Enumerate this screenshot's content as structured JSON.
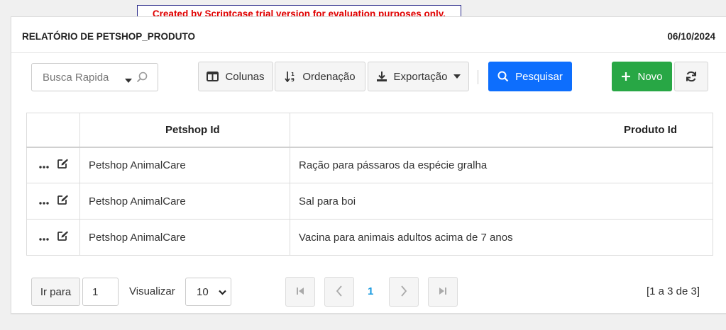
{
  "trial_banner": "Created by Scriptcase trial version for evaluation purposes only.",
  "header": {
    "title": "RELATÓRIO DE PETSHOP_PRODUTO",
    "date": "06/10/2024"
  },
  "toolbar": {
    "quick_search_placeholder": "Busca Rapida",
    "columns_label": "Colunas",
    "sort_label": "Ordenação",
    "export_label": "Exportação",
    "search_label": "Pesquisar",
    "new_label": "Novo"
  },
  "table": {
    "headers": [
      "",
      "Petshop Id",
      "Produto Id"
    ],
    "rows": [
      {
        "petshop": "Petshop AnimalCare",
        "produto": "Ração para pássaros da espécie gralha"
      },
      {
        "petshop": "Petshop AnimalCare",
        "produto": "Sal para boi"
      },
      {
        "petshop": "Petshop AnimalCare",
        "produto": "Vacina para animais adultos acima de 7 anos"
      }
    ]
  },
  "pager": {
    "goto_label": "Ir para",
    "goto_value": "1",
    "view_label": "Visualizar",
    "view_value": "10",
    "current_page": "1",
    "range_text": "[1 a 3 de 3]"
  },
  "colors": {
    "primary": "#0d6efd",
    "success": "#28a745",
    "banner_text": "#e00000",
    "active_page": "#1a9be0"
  }
}
